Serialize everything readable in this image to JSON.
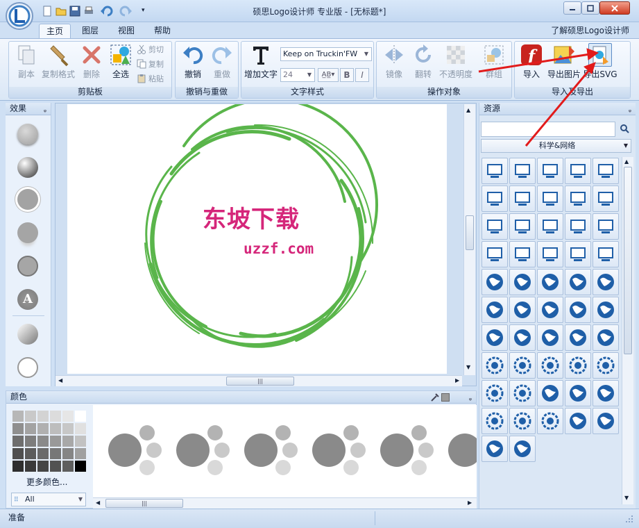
{
  "window": {
    "title": "硕思Logo设计师 专业版 - [无标题*]"
  },
  "tabs": [
    {
      "label": "主页"
    },
    {
      "label": "图层"
    },
    {
      "label": "视图"
    },
    {
      "label": "帮助"
    }
  ],
  "help_link": "了解硕思Logo设计师",
  "ribbon": {
    "clipboard": {
      "label": "剪贴板",
      "copy_page": "副本",
      "format_painter": "复制格式",
      "delete": "删除",
      "select_all": "全选",
      "cut": "剪切",
      "copy": "复制",
      "paste": "粘贴"
    },
    "undo_redo": {
      "label": "撤销与重做",
      "undo": "撤销",
      "redo": "重做"
    },
    "text_style": {
      "label": "文字样式",
      "add_text": "增加文字",
      "font": "Keep on Truckin'FW",
      "size": "24"
    },
    "operate": {
      "label": "操作对象",
      "mirror": "镜像",
      "flip": "翻转",
      "opacity": "不透明度",
      "group": "群组"
    },
    "import_export": {
      "label": "导入及导出",
      "import": "导入",
      "export_image": "导出图片",
      "export_svg": "导出SVG"
    }
  },
  "effects_panel": {
    "title": "效果"
  },
  "canvas": {
    "logo_text": "东坡下载",
    "logo_sub": "uzzf.com",
    "text_color": "#d5267a",
    "ring_color": "#5ab54b"
  },
  "color_panel": {
    "title": "颜色",
    "more_colors": "更多颜色...",
    "filter": "All"
  },
  "resources_panel": {
    "title": "资源",
    "search_placeholder": "",
    "category": "科学&网络"
  },
  "status": {
    "text": "准备"
  }
}
